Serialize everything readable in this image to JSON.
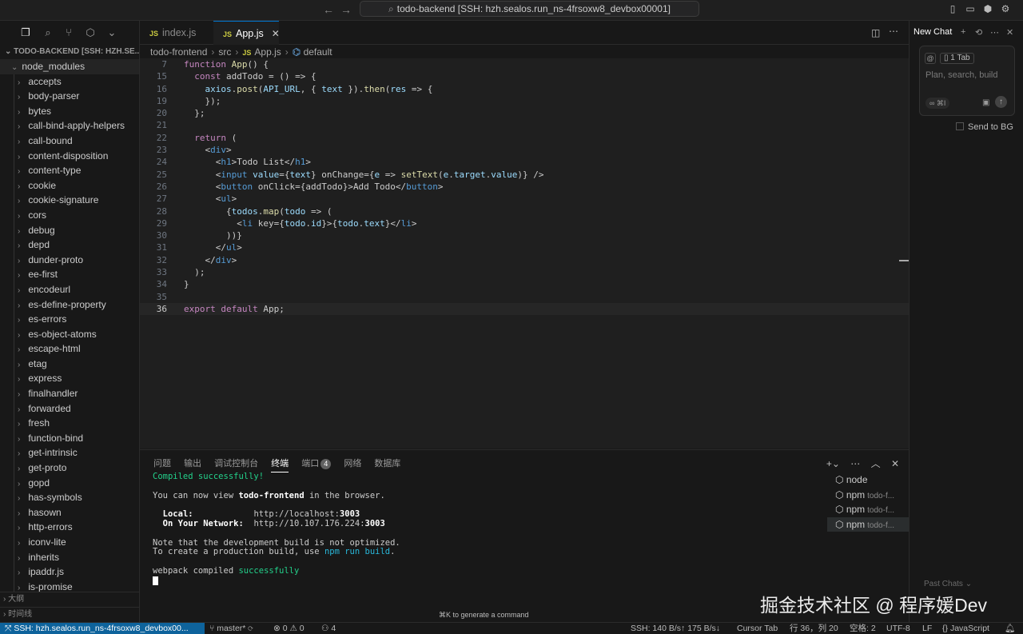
{
  "titlebar": {
    "search_text": "todo-backend [SSH: hzh.sealos.run_ns-4frsoxw8_devbox00001]"
  },
  "sidebar": {
    "header": "TODO-BACKEND [SSH: HZH.SE...",
    "root_folder": "node_modules",
    "items": [
      "accepts",
      "body-parser",
      "bytes",
      "call-bind-apply-helpers",
      "call-bound",
      "content-disposition",
      "content-type",
      "cookie",
      "cookie-signature",
      "cors",
      "debug",
      "depd",
      "dunder-proto",
      "ee-first",
      "encodeurl",
      "es-define-property",
      "es-errors",
      "es-object-atoms",
      "escape-html",
      "etag",
      "express",
      "finalhandler",
      "forwarded",
      "fresh",
      "function-bind",
      "get-intrinsic",
      "get-proto",
      "gopd",
      "has-symbols",
      "hasown",
      "http-errors",
      "iconv-lite",
      "inherits",
      "ipaddr.js",
      "is-promise"
    ],
    "outline_label": "大纲",
    "timeline_label": "时间线"
  },
  "tabs": [
    {
      "label": "index.js",
      "icon": "JS"
    },
    {
      "label": "App.js",
      "icon": "JS"
    }
  ],
  "breadcrumb": [
    "todo-frontend",
    "src",
    "App.js",
    "default"
  ],
  "editor": {
    "lines": [
      {
        "n": "7",
        "t": "function App() {"
      },
      {
        "n": "15",
        "t": "  const addTodo = () => {"
      },
      {
        "n": "16",
        "t": "    axios.post(API_URL, { text }).then(res => {"
      },
      {
        "n": "19",
        "t": "    });"
      },
      {
        "n": "20",
        "t": "  };"
      },
      {
        "n": "21",
        "t": ""
      },
      {
        "n": "22",
        "t": "  return ("
      },
      {
        "n": "23",
        "t": "    <div>"
      },
      {
        "n": "24",
        "t": "      <h1>Todo List</h1>"
      },
      {
        "n": "25",
        "t": "      <input value={text} onChange={e => setText(e.target.value)} />"
      },
      {
        "n": "26",
        "t": "      <button onClick={addTodo}>Add Todo</button>"
      },
      {
        "n": "27",
        "t": "      <ul>"
      },
      {
        "n": "28",
        "t": "        {todos.map(todo => ("
      },
      {
        "n": "29",
        "t": "          <li key={todo.id}>{todo.text}</li>"
      },
      {
        "n": "30",
        "t": "        ))}"
      },
      {
        "n": "31",
        "t": "      </ul>"
      },
      {
        "n": "32",
        "t": "    </div>"
      },
      {
        "n": "33",
        "t": "  );"
      },
      {
        "n": "34",
        "t": "}"
      },
      {
        "n": "35",
        "t": ""
      },
      {
        "n": "36",
        "t": "export default App;"
      }
    ],
    "current_line": "36"
  },
  "panel": {
    "tabs": [
      "问题",
      "输出",
      "调试控制台",
      "终端",
      "端口",
      "网络",
      "数据库"
    ],
    "active_tab": "终端",
    "ports_badge": "4",
    "terminal_lines": [
      "Compiled successfully!",
      "",
      "You can now view todo-frontend in the browser.",
      "",
      "  Local:            http://localhost:3003",
      "  On Your Network:  http://10.107.176.224:3003",
      "",
      "Note that the development build is not optimized.",
      "To create a production build, use npm run build.",
      "",
      "webpack compiled successfully"
    ],
    "terminals": [
      {
        "name": "node",
        "sub": ""
      },
      {
        "name": "npm",
        "sub": "todo-f..."
      },
      {
        "name": "npm",
        "sub": "todo-f..."
      },
      {
        "name": "npm",
        "sub": "todo-f..."
      }
    ],
    "hint": "⌘K to generate a command"
  },
  "chat": {
    "new_chat": "New Chat",
    "tab_chip": "1 Tab",
    "placeholder": "Plan, search, build",
    "mode": "∞ ⌘I",
    "send_to_bg": "Send to BG",
    "past_chats": "Past Chats"
  },
  "statusbar": {
    "remote": "SSH: hzh.sealos.run_ns-4frsoxw8_devbox00...",
    "branch": "master*",
    "problems": "⊗ 0 ⚠ 0",
    "ports": "4",
    "ssh_speed": "SSH: 140 B/s↑ 175 B/s↓",
    "cursor_tab": "Cursor Tab",
    "position": "行 36，列 20",
    "spaces": "空格: 2",
    "encoding": "UTF-8",
    "eol": "LF",
    "language": "JavaScript"
  },
  "watermark": "掘金技术社区 @ 程序媛Dev"
}
